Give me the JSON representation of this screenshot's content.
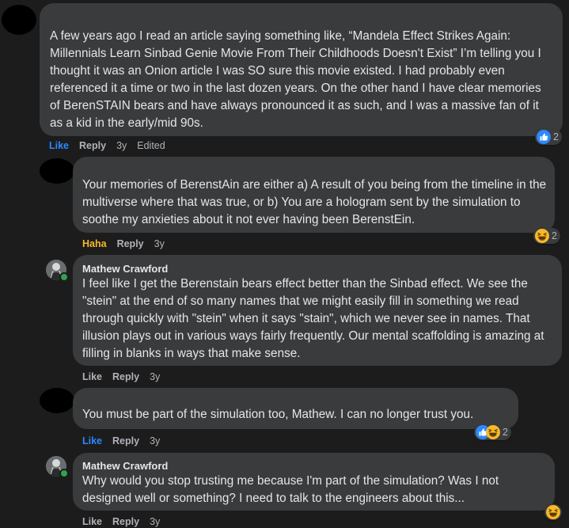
{
  "comments": [
    {
      "author": "",
      "text": "A few years ago I read an article saying something like, “Mandela Effect Strikes Again: Millennials Learn Sinbad Genie Movie From Their Childhoods Doesn't Exist” I’m telling you I thought it was an Onion article I was SO sure this movie existed. I had probably even referenced it a time or two in the last dozen years. On the other hand I have clear memories of BerenSTAIN bears and have always pronounced it as such, and I was a massive fan of it as a kid in the early/mid 90s.",
      "like_label": "Like",
      "reply_label": "Reply",
      "time": "3y",
      "edited": "Edited",
      "reaction_count": "2",
      "reaction_icons": [
        "like-icon"
      ]
    },
    {
      "author": "",
      "text": "Your memories of BerenstAin are either a) A result of you being from the timeline in the multiverse where that was true, or b) You are a hologram sent by the simulation to soothe my anxieties about it not ever having been BerenstEin.",
      "like_label": "Haha",
      "reply_label": "Reply",
      "time": "3y",
      "reaction_count": "2",
      "reaction_icons": [
        "haha-icon"
      ]
    },
    {
      "author": "Mathew Crawford",
      "text": "I feel like I get the Berenstain bears effect better than the Sinbad effect. We see the \"stein\" at the end of so many names that we might easily fill in something we read through quickly with \"stein\" when it says \"stain\", which we never see in names. That illusion plays out in various ways fairly frequently. Our mental scaffolding is amazing at filling in blanks in ways that make sense.",
      "like_label": "Like",
      "reply_label": "Reply",
      "time": "3y"
    },
    {
      "author": "",
      "text": "You must be part of the simulation too, Mathew. I can no longer trust you.",
      "like_label": "Like",
      "reply_label": "Reply",
      "time": "3y",
      "reaction_count": "2",
      "reaction_icons": [
        "like-icon",
        "haha-icon"
      ]
    },
    {
      "author": "Mathew Crawford",
      "text": "Why would you stop trusting me because I'm part of the simulation? Was I not designed well or something? I need to talk to the engineers about this...",
      "like_label": "Like",
      "reply_label": "Reply",
      "time": "3y",
      "reaction_icons": [
        "haha-icon"
      ]
    }
  ],
  "colors": {
    "background": "#1c1c1d",
    "bubble": "#3a3b3c",
    "text": "#e4e6eb",
    "secondary": "#b0b3b8",
    "like_blue": "#2d88ff",
    "haha_yellow": "#f7b928",
    "online_green": "#31a24c"
  }
}
